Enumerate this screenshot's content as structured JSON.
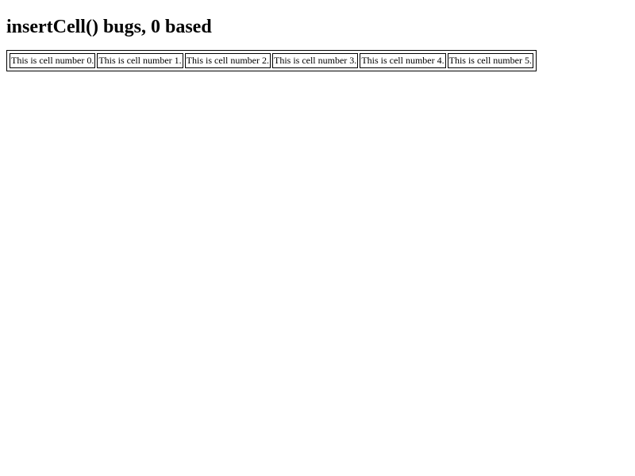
{
  "page": {
    "title": "insertCell() bugs, 0 based"
  },
  "table": {
    "cells": [
      "This is cell number 0.",
      "This is cell number 1.",
      "This is cell number 2.",
      "This is cell number 3.",
      "This is cell number 4.",
      "This is cell number 5."
    ]
  }
}
